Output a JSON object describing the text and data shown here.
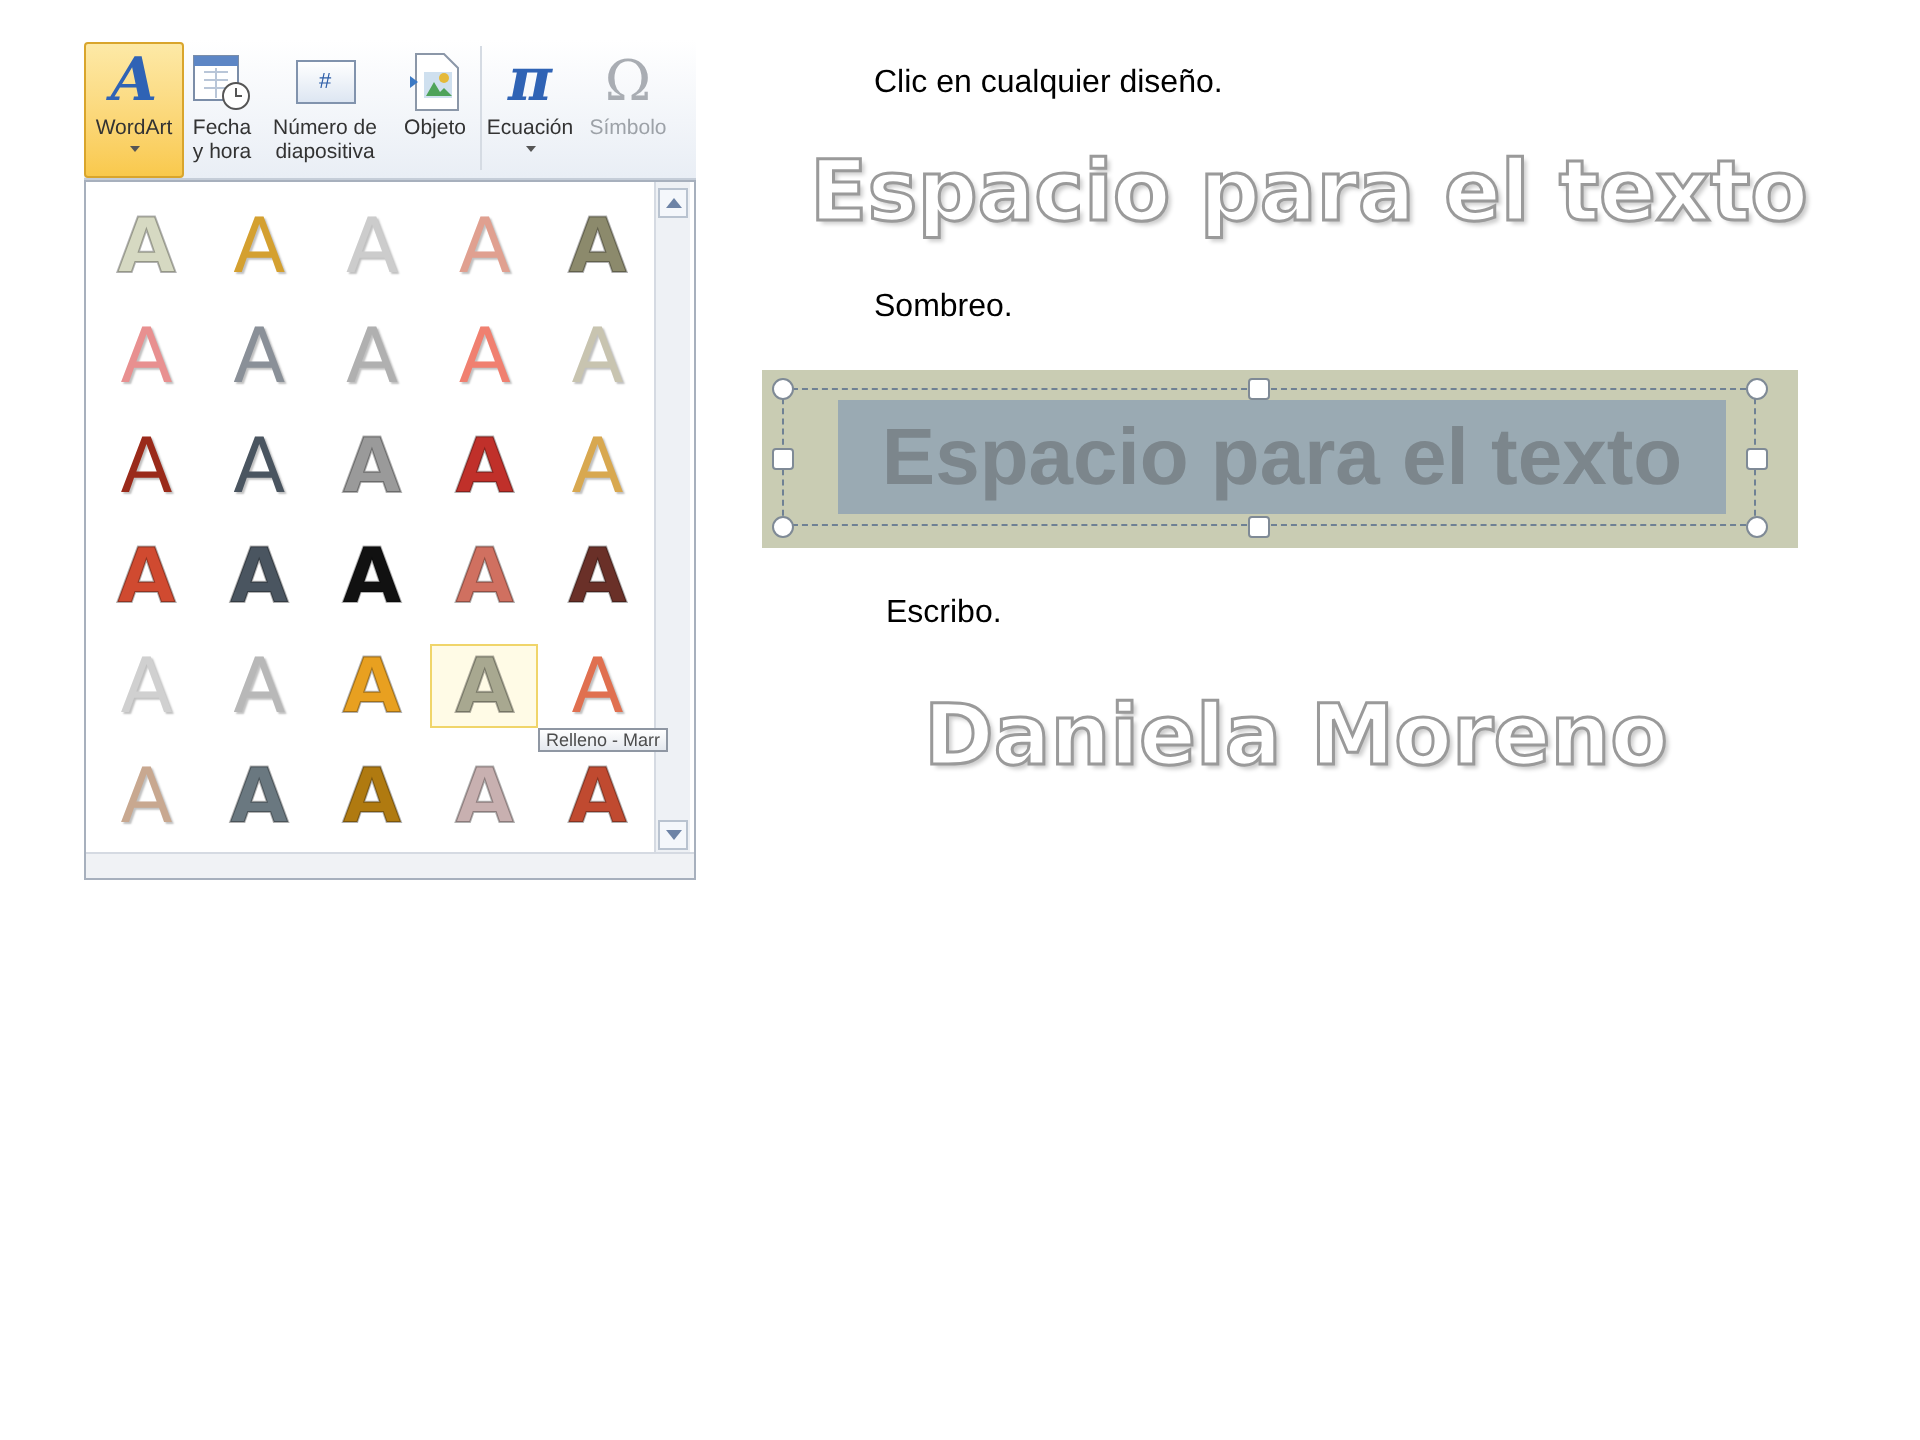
{
  "ribbon": {
    "buttons": [
      {
        "label": "WordArt",
        "icon": "A",
        "kind": "split",
        "selected": true,
        "disabled": false
      },
      {
        "label": "Fecha y hora",
        "kind": "calendar",
        "selected": false,
        "disabled": false
      },
      {
        "label": "Número de diapositiva",
        "icon": "#",
        "kind": "slide-number",
        "selected": false,
        "disabled": false
      },
      {
        "label": "Objeto",
        "kind": "object",
        "selected": false,
        "disabled": false
      },
      {
        "label": "Ecuación",
        "icon": "π",
        "kind": "split",
        "selected": false,
        "disabled": false
      },
      {
        "label": "Símbolo",
        "icon": "Ω",
        "kind": "plain",
        "selected": false,
        "disabled": true
      }
    ]
  },
  "gallery": {
    "tooltip": "Relleno - Marr",
    "items": [
      {
        "label": "A",
        "kind": "solid",
        "color": "#d6d9c2",
        "selected": false
      },
      {
        "label": "A",
        "kind": "outline",
        "color": "#d4a030",
        "selected": false
      },
      {
        "label": "A",
        "kind": "outline",
        "color": "#cccccc",
        "selected": false
      },
      {
        "label": "A",
        "kind": "outline",
        "color": "#e0a090",
        "selected": false
      },
      {
        "label": "A",
        "kind": "solid",
        "color": "#8c8a6c",
        "selected": false
      },
      {
        "label": "A",
        "kind": "outline",
        "color": "#e89090",
        "selected": false
      },
      {
        "label": "A",
        "kind": "outline",
        "color": "#8a9098",
        "selected": false
      },
      {
        "label": "A",
        "kind": "outline",
        "color": "#b0b0b0",
        "selected": false
      },
      {
        "label": "A",
        "kind": "outline",
        "color": "#f08070",
        "selected": false
      },
      {
        "label": "A",
        "kind": "outline",
        "color": "#c8c4b0",
        "selected": false
      },
      {
        "label": "A",
        "kind": "outline",
        "color": "#9a2a1a",
        "selected": false
      },
      {
        "label": "A",
        "kind": "outline",
        "color": "#4a5560",
        "selected": false
      },
      {
        "label": "A",
        "kind": "solid",
        "color": "#9a9a9a",
        "selected": false
      },
      {
        "label": "A",
        "kind": "solid",
        "color": "#c0302a",
        "selected": false
      },
      {
        "label": "A",
        "kind": "outline",
        "color": "#d8a850",
        "selected": false
      },
      {
        "label": "A",
        "kind": "solid",
        "color": "#d04a30",
        "selected": false
      },
      {
        "label": "A",
        "kind": "solid",
        "color": "#4a5560",
        "selected": false
      },
      {
        "label": "A",
        "kind": "solid",
        "color": "#111111",
        "selected": false
      },
      {
        "label": "A",
        "kind": "solid",
        "color": "#d07060",
        "selected": false
      },
      {
        "label": "A",
        "kind": "solid",
        "color": "#6a3028",
        "selected": false
      },
      {
        "label": "A",
        "kind": "outline",
        "color": "#d0d0d0",
        "selected": false
      },
      {
        "label": "A",
        "kind": "outline",
        "color": "#b8b8b8",
        "selected": false
      },
      {
        "label": "A",
        "kind": "solid",
        "color": "#e8a020",
        "selected": false
      },
      {
        "label": "A",
        "kind": "solid",
        "color": "#a8a890",
        "selected": true
      },
      {
        "label": "A",
        "kind": "outline",
        "color": "#e07050",
        "selected": false
      },
      {
        "label": "A",
        "kind": "outline",
        "color": "#c8a890",
        "selected": false
      },
      {
        "label": "A",
        "kind": "solid",
        "color": "#6a7880",
        "selected": false
      },
      {
        "label": "A",
        "kind": "solid",
        "color": "#b07a10",
        "selected": false
      },
      {
        "label": "A",
        "kind": "solid",
        "color": "#c8b0b0",
        "selected": false
      },
      {
        "label": "A",
        "kind": "solid",
        "color": "#c04a30",
        "selected": false
      }
    ]
  },
  "slide": {
    "items": [
      {
        "kind": "caption",
        "text": "Clic en cualquier diseño."
      },
      {
        "kind": "wordart",
        "text": "Espacio para el texto"
      },
      {
        "kind": "caption",
        "text": "Sombreo."
      },
      {
        "kind": "shaded",
        "text": "Espacio para el texto"
      },
      {
        "kind": "caption",
        "text": "Escribo."
      },
      {
        "kind": "wordart",
        "text": "Daniela Moreno"
      }
    ]
  }
}
